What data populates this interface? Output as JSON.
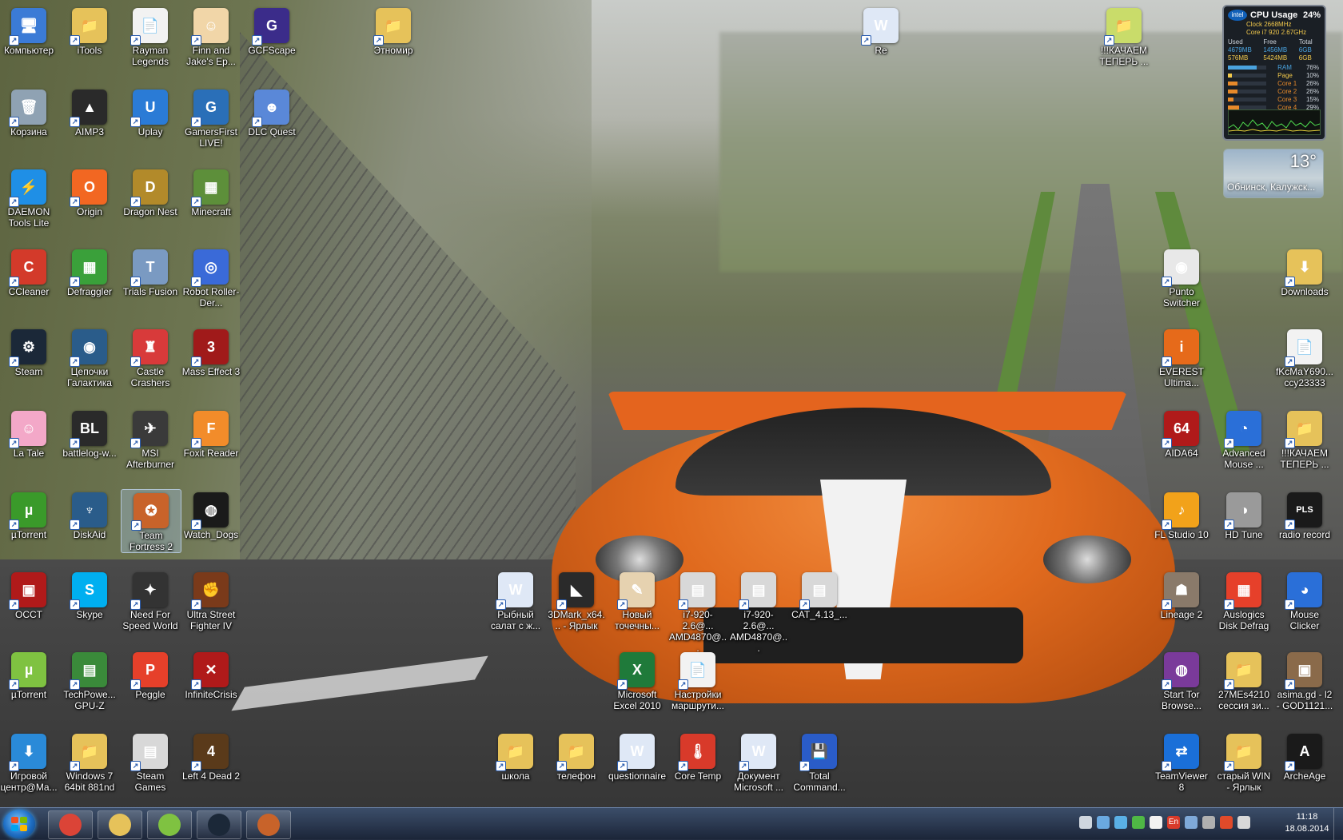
{
  "desktop_icons": [
    {
      "label": "Компьютер",
      "color": "#3b7bd6",
      "glyph": "🖥"
    },
    {
      "label": "iTools",
      "color": "#e6c25a",
      "glyph": "📁"
    },
    {
      "label": "Rayman Legends",
      "color": "#f2f2f2",
      "glyph": "📄"
    },
    {
      "label": "Finn and Jake's Ep...",
      "color": "#f1d6a8",
      "glyph": "☺"
    },
    {
      "label": "GCFScape",
      "color": "#3b2c8a",
      "glyph": "G"
    },
    {
      "label": "Этномир",
      "color": "#e6c25a",
      "glyph": "📁"
    },
    {
      "label": "Re",
      "color": "#dfe8f6",
      "glyph": "W"
    },
    {
      "label": "!!!КАЧАЕМ ТЕПЕРЬ ...",
      "color": "#c9dc6a",
      "glyph": "📁"
    },
    {
      "label": "Корзина",
      "color": "#8fa2b3",
      "glyph": "🗑"
    },
    {
      "label": "AIMP3",
      "color": "#2a2a2a",
      "glyph": "▲"
    },
    {
      "label": "Uplay",
      "color": "#2a7bd6",
      "glyph": "U"
    },
    {
      "label": "GamersFirst LIVE!",
      "color": "#2a6fb8",
      "glyph": "G"
    },
    {
      "label": "DLC Quest",
      "color": "#5a88d8",
      "glyph": "☻"
    },
    {
      "label": "DAEMON Tools Lite",
      "color": "#1f8fe6",
      "glyph": "⚡"
    },
    {
      "label": "Origin",
      "color": "#f26722",
      "glyph": "O"
    },
    {
      "label": "Dragon Nest",
      "color": "#b28a2a",
      "glyph": "D"
    },
    {
      "label": "Minecraft",
      "color": "#5d8f3a",
      "glyph": "▦"
    },
    {
      "label": "CCleaner",
      "color": "#d33a2a",
      "glyph": "C"
    },
    {
      "label": "Defraggler",
      "color": "#3aa03a",
      "glyph": "▦"
    },
    {
      "label": "Trials Fusion",
      "color": "#7a9ac2",
      "glyph": "T"
    },
    {
      "label": "Robot Roller-Der...",
      "color": "#3a6ad8",
      "glyph": "◎"
    },
    {
      "label": "Steam",
      "color": "#1b2838",
      "glyph": "⚙"
    },
    {
      "label": "Цепочки Галактика",
      "color": "#2a5c8a",
      "glyph": "◉"
    },
    {
      "label": "Castle Crashers",
      "color": "#d83a3a",
      "glyph": "♜"
    },
    {
      "label": "Mass Effect 3",
      "color": "#a01a1a",
      "glyph": "3"
    },
    {
      "label": "La Tale",
      "color": "#f3a8c8",
      "glyph": "☺"
    },
    {
      "label": "battlelog-w...",
      "color": "#2a2a2a",
      "glyph": "BL"
    },
    {
      "label": "MSI Afterburner",
      "color": "#3a3a3a",
      "glyph": "✈"
    },
    {
      "label": "Foxit Reader",
      "color": "#f28c2a",
      "glyph": "F"
    },
    {
      "label": "µTorrent",
      "color": "#3a9a2a",
      "glyph": "µ"
    },
    {
      "label": "DiskAid",
      "color": "#2a5c8a",
      "glyph": "♆"
    },
    {
      "label": "Team Fortress 2",
      "color": "#c8632a",
      "glyph": "✪",
      "selected": true
    },
    {
      "label": "Watch_Dogs",
      "color": "#1a1a1a",
      "glyph": "◍"
    },
    {
      "label": "OCCT",
      "color": "#b01a1a",
      "glyph": "▣"
    },
    {
      "label": "Skype",
      "color": "#00aff0",
      "glyph": "S"
    },
    {
      "label": "Need For Speed World",
      "color": "#333333",
      "glyph": "✦"
    },
    {
      "label": "Ultra Street Fighter IV",
      "color": "#7a3a1a",
      "glyph": "✊"
    },
    {
      "label": "µTorrent",
      "color": "#7fc241",
      "glyph": "µ"
    },
    {
      "label": "TechPowe... GPU-Z",
      "color": "#3a8a3a",
      "glyph": "▤"
    },
    {
      "label": "Peggle",
      "color": "#e6402a",
      "glyph": "P"
    },
    {
      "label": "InfiniteCrisis",
      "color": "#b01a1a",
      "glyph": "✕"
    },
    {
      "label": "Игровой центр@Ma...",
      "color": "#2a8ad8",
      "glyph": "⬇"
    },
    {
      "label": "Windows 7 64bit 881nd",
      "color": "#e6c25a",
      "glyph": "📁"
    },
    {
      "label": "Steam Games",
      "color": "#d8d8d8",
      "glyph": "▤"
    },
    {
      "label": "Left 4 Dead 2",
      "color": "#5a3a1a",
      "glyph": "4"
    },
    {
      "label": "Рыбный салат с ж...",
      "color": "#dfe8f6",
      "glyph": "W"
    },
    {
      "label": "3DMark_x64... - Ярлык",
      "color": "#2a2a2a",
      "glyph": "◣"
    },
    {
      "label": "Новый точечны...",
      "color": "#e6d2b0",
      "glyph": "✎"
    },
    {
      "label": "i7-920-2.6@... AMD4870@...",
      "color": "#d8d8d8",
      "glyph": "▤"
    },
    {
      "label": "i7-920-2.6@... AMD4870@...",
      "color": "#d8d8d8",
      "glyph": "▤"
    },
    {
      "label": "CAT_4.13_...",
      "color": "#d8d8d8",
      "glyph": "▤"
    },
    {
      "label": "Microsoft Excel 2010",
      "color": "#1f7a3a",
      "glyph": "X"
    },
    {
      "label": "Настройки маршрути...",
      "color": "#f2f2f2",
      "glyph": "📄"
    },
    {
      "label": "школа",
      "color": "#e6c25a",
      "glyph": "📁"
    },
    {
      "label": "телефон",
      "color": "#e6c25a",
      "glyph": "📁"
    },
    {
      "label": "questionnaire",
      "color": "#dfe8f6",
      "glyph": "W"
    },
    {
      "label": "Core Temp",
      "color": "#d83a2a",
      "glyph": "🌡"
    },
    {
      "label": "Документ Microsoft ...",
      "color": "#dfe8f6",
      "glyph": "W"
    },
    {
      "label": "Total Command...",
      "color": "#2a5cc8",
      "glyph": "💾"
    },
    {
      "label": "Punto Switcher",
      "color": "#e8e8e8",
      "glyph": "◉"
    },
    {
      "label": "Downloads",
      "color": "#e6c25a",
      "glyph": "⬇"
    },
    {
      "label": "EVEREST Ultima...",
      "color": "#e66a1a",
      "glyph": "i"
    },
    {
      "label": "fKcMaY690... ccy23333",
      "color": "#f2f2f2",
      "glyph": "📄"
    },
    {
      "label": "AIDA64",
      "color": "#b01a1a",
      "glyph": "64"
    },
    {
      "label": "Advanced Mouse ...",
      "color": "#2a6fd8",
      "glyph": "◔"
    },
    {
      "label": "!!!КАЧАЕМ ТЕПЕРЬ ...",
      "color": "#e6c25a",
      "glyph": "📁"
    },
    {
      "label": "FL Studio 10",
      "color": "#f2a21a",
      "glyph": "♪"
    },
    {
      "label": "HD Tune",
      "color": "#9a9a9a",
      "glyph": "◑"
    },
    {
      "label": "radio record",
      "color": "#1a1a1a",
      "glyph": "PLS"
    },
    {
      "label": "Lineage 2",
      "color": "#8a7a6a",
      "glyph": "☗"
    },
    {
      "label": "Auslogics Disk Defrag",
      "color": "#e6402a",
      "glyph": "▦"
    },
    {
      "label": "Mouse Clicker",
      "color": "#2a6fd8",
      "glyph": "◕"
    },
    {
      "label": "Start Tor Browse...",
      "color": "#7a3a9a",
      "glyph": "◍"
    },
    {
      "label": "27MEs4210 сессия зи...",
      "color": "#e6c25a",
      "glyph": "📁"
    },
    {
      "label": "asima.gd - l2 - GOD1121...",
      "color": "#8a6a4a",
      "glyph": "▣"
    },
    {
      "label": "TeamViewer 8",
      "color": "#1a6fd8",
      "glyph": "⇄"
    },
    {
      "label": "старый WIN - Ярлык",
      "color": "#e6c25a",
      "glyph": "📁"
    },
    {
      "label": "ArcheAge",
      "color": "#1a1a1a",
      "glyph": "A"
    }
  ],
  "cpu_gadget": {
    "brand": "intel",
    "title": "CPU Usage",
    "usage": "24%",
    "clock": "Clock 2668MHz",
    "model": "Core i7 920 2.67GHz",
    "columns": [
      "Used",
      "Free",
      "Total"
    ],
    "rows": [
      {
        "used": "4679MB",
        "free": "1456MB",
        "total": "6GB"
      },
      {
        "used": "576MB",
        "free": "5424MB",
        "total": "6GB"
      }
    ],
    "bars": [
      {
        "name": "RAM",
        "value": "76%",
        "level": 0.76,
        "color": "#4aa3df"
      },
      {
        "name": "Page",
        "value": "10%",
        "level": 0.1,
        "color": "#f2c94c"
      },
      {
        "name": "Core 1",
        "value": "26%",
        "level": 0.26,
        "color": "#e88a2a"
      },
      {
        "name": "Core 2",
        "value": "26%",
        "level": 0.26,
        "color": "#e88a2a"
      },
      {
        "name": "Core 3",
        "value": "15%",
        "level": 0.15,
        "color": "#e88a2a"
      },
      {
        "name": "Core 4",
        "value": "29%",
        "level": 0.29,
        "color": "#e88a2a"
      }
    ]
  },
  "weather_gadget": {
    "temperature": "13°",
    "location": "Обнинск, Калужск..."
  },
  "taskbar": {
    "pinned": [
      {
        "name": "chrome",
        "color": "#db4437"
      },
      {
        "name": "explorer",
        "color": "#e6c25a"
      },
      {
        "name": "utorrent",
        "color": "#7fc241"
      },
      {
        "name": "steam",
        "color": "#1b2838"
      },
      {
        "name": "team-fortress-2",
        "color": "#c8632a"
      }
    ],
    "tray_icons": [
      "#cfd6de",
      "#6aa9e0",
      "#5ab0e6",
      "#4fb845",
      "#f2f2f2",
      "#d83a2a",
      "#7fa9d8",
      "#b0b0b0",
      "#e04a2a",
      "#d8d8d8"
    ],
    "language": "En",
    "time": "11:18",
    "date": "18.08.2014"
  }
}
